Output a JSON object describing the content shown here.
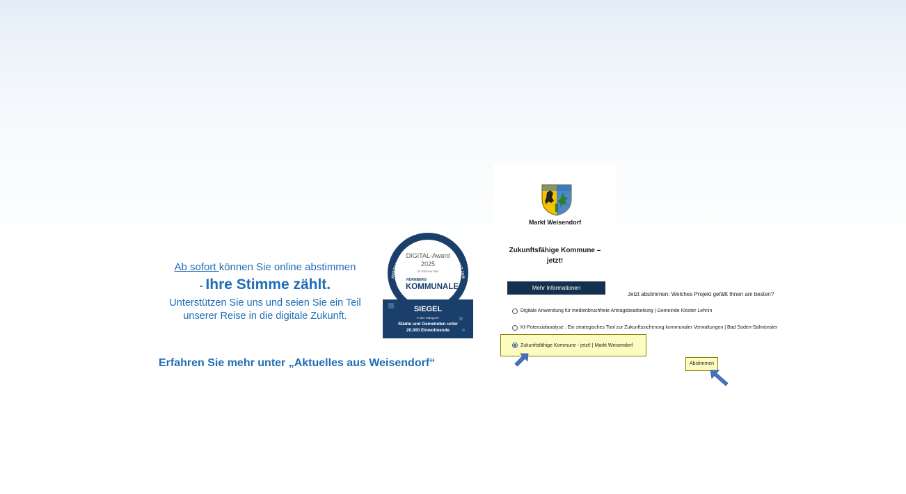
{
  "intro": {
    "line1_link": "Ab sofort ",
    "line1_rest": "können Sie online abstimmen",
    "line2_dash": "- ",
    "line2_strong": "Ihre Stimme zählt.",
    "line3a": "Unterstützen Sie uns und seien Sie ein Teil",
    "line3b": "unserer Reise in die digitale Zukunft.",
    "more_info": "Erfahren Sie mehr unter „Aktuelles aus Weisendorf“"
  },
  "badge": {
    "ring_text": "AUSZEICHNUNG FÜR EIN EXZELLENTES PROJEKT ZUR DIGITALISIERUNG DER VERWALTUNG",
    "award": "DIGITAL-Award",
    "year": "2025",
    "framework": "im Rahmen der",
    "city": "NÜRNBERG",
    "brand": "KOMMUNALE",
    "seal": "SIEGEL",
    "category_label": "in der Kategorie",
    "category_line1": "Städte und Gemeinden unter",
    "category_line2": "20.000 Einwohnende"
  },
  "card": {
    "org_name": "Markt Weisendorf",
    "title_line1": "Zukunftsfähige Kommune –",
    "title_line2": "jetzt!",
    "more_button": "Mehr Informationen"
  },
  "poll": {
    "question": "Jetzt abstimmen: Welches Projekt gefällt Ihnen am besten?",
    "options": [
      {
        "label": "Digitale Anwendung für medienbruchfreie Antragsbearbeitung | Gemeinde Kloster Lehnin",
        "selected": false
      },
      {
        "label": "KI-Potenzialanalyse : Ein strategisches Tool zur Zukunftssicherung kommunaler Verwaltungen | Bad Soden-Salmünster",
        "selected": false
      },
      {
        "label": "Zukunftsfähige Kommune - jetzt! | Markt Weisendorf",
        "selected": true
      }
    ],
    "vote_button": "Abstimmen"
  },
  "colors": {
    "text_blue": "#1f6db5",
    "badge_navy": "#1a3f6b",
    "button_navy": "#13304f",
    "highlight_yellow": "#fdfcc0",
    "arrow_blue": "#4472c4"
  },
  "icons": [
    "crest-icon",
    "pointer-arrow-icon"
  ]
}
